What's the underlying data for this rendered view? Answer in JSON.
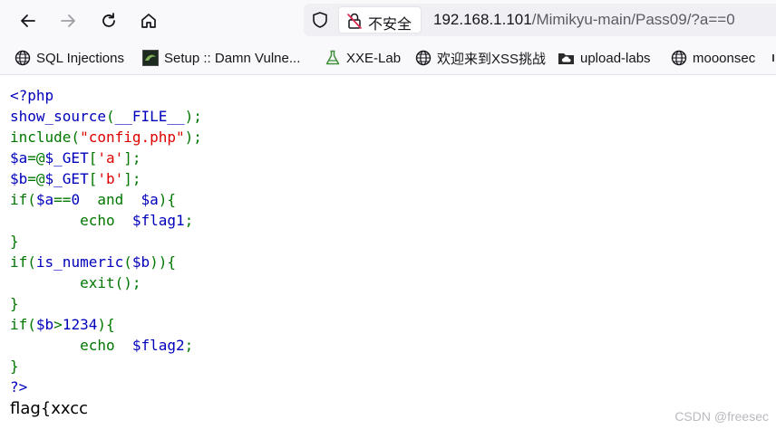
{
  "toolbar": {
    "insecure_label": "不安全",
    "url_host": "192.168.1.101",
    "url_path": "/Mimikyu-main/Pass09/?a==0"
  },
  "bookmarks": [
    {
      "label": "SQL Injections",
      "icon": "globe-icon"
    },
    {
      "label": "Setup :: Damn Vulne...",
      "icon": "dvwa-favicon-icon"
    },
    {
      "label": "XXE-Lab",
      "icon": "flask-icon"
    },
    {
      "label": "欢迎来到XSS挑战",
      "icon": "globe-icon"
    },
    {
      "label": "upload-labs",
      "icon": "folder-cloud-icon"
    },
    {
      "label": "mooonsec",
      "icon": "globe-icon"
    }
  ],
  "source_code": {
    "lines": [
      [
        {
          "t": "<?php",
          "c": "def"
        }
      ],
      [
        {
          "t": "show_source",
          "c": "def"
        },
        {
          "t": "(",
          "c": "kw"
        },
        {
          "t": "__FILE__",
          "c": "def"
        },
        {
          "t": ");",
          "c": "kw"
        }
      ],
      [
        {
          "t": "include(",
          "c": "kw"
        },
        {
          "t": "\"config.php\"",
          "c": "str"
        },
        {
          "t": ");",
          "c": "kw"
        }
      ],
      [
        {
          "t": "$a",
          "c": "def"
        },
        {
          "t": "=@",
          "c": "kw"
        },
        {
          "t": "$_GET",
          "c": "def"
        },
        {
          "t": "[",
          "c": "kw"
        },
        {
          "t": "'a'",
          "c": "str"
        },
        {
          "t": "];",
          "c": "kw"
        }
      ],
      [
        {
          "t": "$b",
          "c": "def"
        },
        {
          "t": "=@",
          "c": "kw"
        },
        {
          "t": "$_GET",
          "c": "def"
        },
        {
          "t": "[",
          "c": "kw"
        },
        {
          "t": "'b'",
          "c": "str"
        },
        {
          "t": "];",
          "c": "kw"
        }
      ],
      [
        {
          "t": "if(",
          "c": "kw"
        },
        {
          "t": "$a",
          "c": "def"
        },
        {
          "t": "==",
          "c": "kw"
        },
        {
          "t": "0",
          "c": "def"
        },
        {
          "t": "  and  ",
          "c": "kw"
        },
        {
          "t": "$a",
          "c": "def"
        },
        {
          "t": "){",
          "c": "kw"
        }
      ],
      [
        {
          "t": "        echo  ",
          "c": "kw"
        },
        {
          "t": "$flag1",
          "c": "def"
        },
        {
          "t": ";",
          "c": "kw"
        }
      ],
      [
        {
          "t": "}",
          "c": "kw"
        }
      ],
      [
        {
          "t": "if(",
          "c": "kw"
        },
        {
          "t": "is_numeric",
          "c": "def"
        },
        {
          "t": "(",
          "c": "kw"
        },
        {
          "t": "$b",
          "c": "def"
        },
        {
          "t": ")){",
          "c": "kw"
        }
      ],
      [
        {
          "t": "        exit",
          "c": "kw"
        },
        {
          "t": "();",
          "c": "kw"
        }
      ],
      [
        {
          "t": "}",
          "c": "kw"
        }
      ],
      [
        {
          "t": "if(",
          "c": "kw"
        },
        {
          "t": "$b",
          "c": "def"
        },
        {
          "t": ">",
          "c": "kw"
        },
        {
          "t": "1234",
          "c": "def"
        },
        {
          "t": "){",
          "c": "kw"
        }
      ],
      [
        {
          "t": "        echo  ",
          "c": "kw"
        },
        {
          "t": "$flag2",
          "c": "def"
        },
        {
          "t": ";",
          "c": "kw"
        }
      ],
      [
        {
          "t": "}",
          "c": "kw"
        }
      ],
      [
        {
          "t": "?>",
          "c": "def"
        }
      ]
    ]
  },
  "output": {
    "flag_text": "flag{xxcc"
  },
  "watermark": "CSDN @freesec",
  "colors": {
    "php_default": "#0000bb",
    "php_keyword": "#007700",
    "php_string": "#dd0000"
  }
}
